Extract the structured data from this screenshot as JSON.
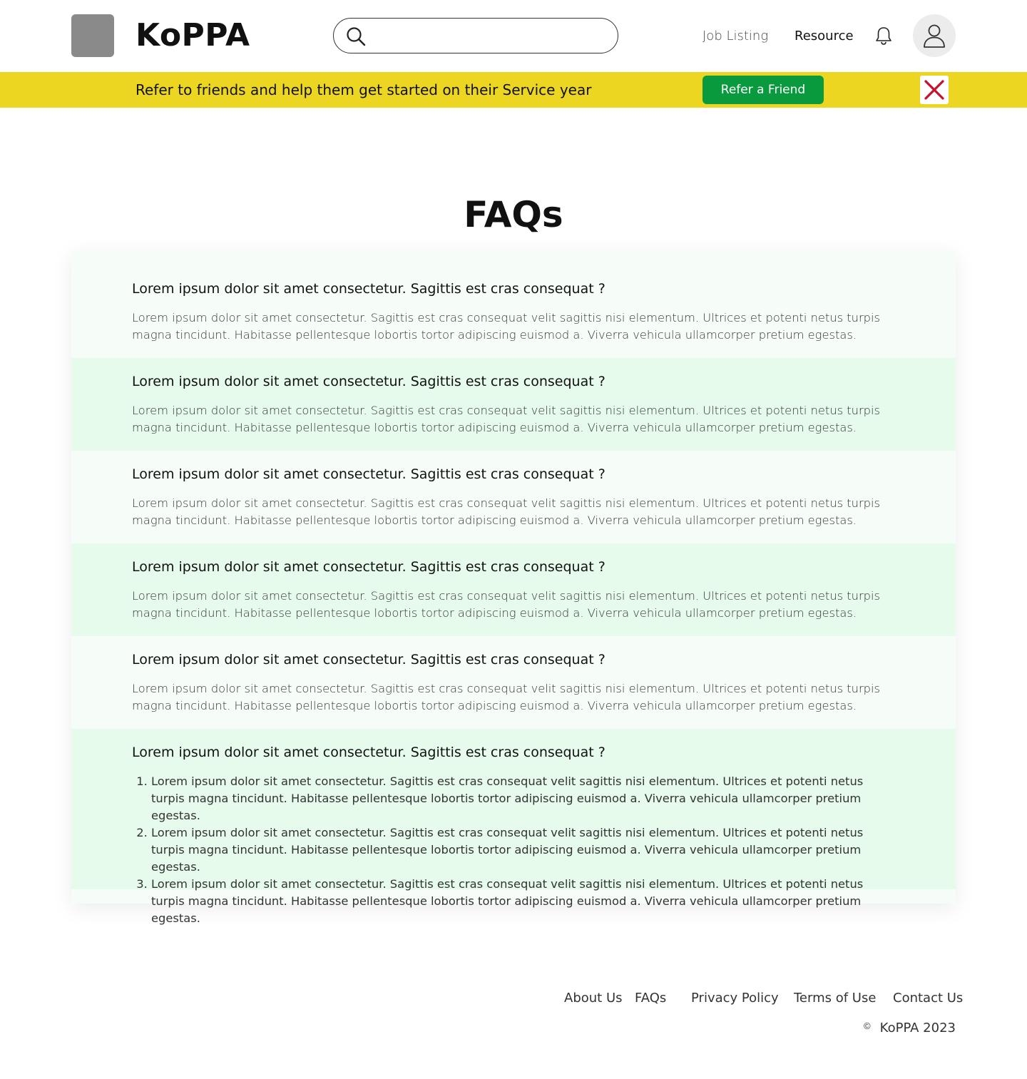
{
  "header": {
    "brand": "KoPPA",
    "search": {
      "value": "",
      "placeholder": ""
    },
    "nav": {
      "job_listing": "Job Listing",
      "resource": "Resource"
    }
  },
  "banner": {
    "text": "Refer to friends and help them get started on their Service year",
    "button_label": "Refer a Friend"
  },
  "main": {
    "title": "FAQs",
    "faqs": [
      {
        "question": "Lorem ipsum dolor sit amet consectetur. Sagittis est cras consequat ?",
        "answer": "Lorem ipsum dolor sit amet consectetur. Sagittis est cras consequat velit sagittis nisi elementum. Ultrices et potenti netus turpis magna tincidunt. Habitasse pellentesque lobortis tortor adipiscing euismod a. Viverra vehicula ullamcorper pretium egestas."
      },
      {
        "question": "Lorem ipsum dolor sit amet consectetur. Sagittis est cras consequat ?",
        "answer": "Lorem ipsum dolor sit amet consectetur. Sagittis est cras consequat velit sagittis nisi elementum. Ultrices et potenti netus turpis magna tincidunt. Habitasse pellentesque lobortis tortor adipiscing euismod a. Viverra vehicula ullamcorper pretium egestas."
      },
      {
        "question": "Lorem ipsum dolor sit amet consectetur. Sagittis est cras consequat ?",
        "answer": "Lorem ipsum dolor sit amet consectetur. Sagittis est cras consequat velit sagittis nisi elementum. Ultrices et potenti netus turpis magna tincidunt. Habitasse pellentesque lobortis tortor adipiscing euismod a. Viverra vehicula ullamcorper pretium egestas."
      },
      {
        "question": "Lorem ipsum dolor sit amet consectetur. Sagittis est cras consequat ?",
        "answer": "Lorem ipsum dolor sit amet consectetur. Sagittis est cras consequat velit sagittis nisi elementum. Ultrices et potenti netus turpis magna tincidunt. Habitasse pellentesque lobortis tortor adipiscing euismod a. Viverra vehicula ullamcorper pretium egestas."
      },
      {
        "question": "Lorem ipsum dolor sit amet consectetur. Sagittis est cras consequat ?",
        "answer": "Lorem ipsum dolor sit amet consectetur. Sagittis est cras consequat velit sagittis nisi elementum. Ultrices et potenti netus turpis magna tincidunt. Habitasse pellentesque lobortis tortor adipiscing euismod a. Viverra vehicula ullamcorper pretium egestas."
      },
      {
        "question": "Lorem ipsum dolor sit amet consectetur. Sagittis est cras consequat ?",
        "list": [
          "Lorem ipsum dolor sit amet consectetur. Sagittis est cras consequat velit sagittis nisi elementum. Ultrices et potenti netus turpis magna tincidunt. Habitasse pellentesque lobortis tortor adipiscing euismod a. Viverra vehicula ullamcorper pretium egestas.",
          "Lorem ipsum dolor sit amet consectetur. Sagittis est cras consequat velit sagittis nisi elementum. Ultrices et potenti netus turpis magna tincidunt. Habitasse pellentesque lobortis tortor adipiscing euismod a. Viverra vehicula ullamcorper pretium egestas.",
          "Lorem ipsum dolor sit amet consectetur. Sagittis est cras consequat velit sagittis nisi elementum. Ultrices et potenti netus turpis magna tincidunt. Habitasse pellentesque lobortis tortor adipiscing euismod a. Viverra vehicula ullamcorper pretium egestas."
        ]
      }
    ]
  },
  "footer": {
    "links": {
      "about": "About Us",
      "faqs": "FAQs",
      "privacy": "Privacy Policy",
      "terms": "Terms of Use",
      "contact": "Contact Us"
    },
    "copyright_symbol": "©",
    "copyright": "KoPPA 2023"
  },
  "colors": {
    "banner": "#ecd622",
    "refer_button": "#0a9a3e",
    "close_icon": "#c8102e",
    "faq_alt_row": "#e6fbec",
    "faq_plain_row": "#f6fdf8"
  },
  "icons": [
    "logo-placeholder",
    "search-icon",
    "bell-icon",
    "user-icon",
    "close-icon"
  ]
}
